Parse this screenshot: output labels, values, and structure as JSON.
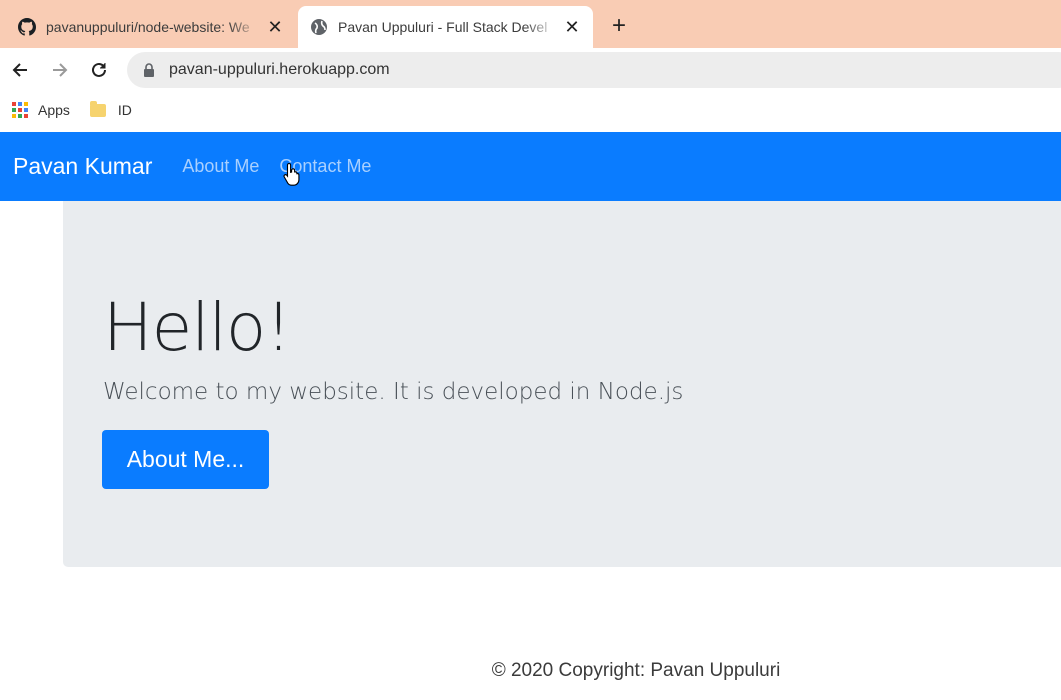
{
  "browser": {
    "tabs": [
      {
        "title": "pavanuppuluri/node-website: We",
        "favicon": "github-icon",
        "active": false
      },
      {
        "title": "Pavan Uppuluri - Full Stack Devel",
        "favicon": "globe-icon",
        "active": true
      }
    ],
    "new_tab_label": "+",
    "url": "pavan-uppuluri.herokuapp.com",
    "bookmarks": [
      {
        "label": "Apps",
        "icon": "apps-grid-icon"
      },
      {
        "label": "ID",
        "icon": "folder-icon"
      }
    ]
  },
  "site": {
    "brand": "Pavan Kumar",
    "nav_links": [
      "About Me",
      "Contact Me"
    ],
    "hero": {
      "heading": "Hello!",
      "lead": "Welcome to my website. It is developed in Node.js",
      "button": "About Me..."
    },
    "footer": "© 2020 Copyright: Pavan Uppuluri"
  },
  "colors": {
    "tabstrip": "#f9ccb4",
    "primary": "#0a7cff",
    "jumbotron": "#e9ecef"
  }
}
